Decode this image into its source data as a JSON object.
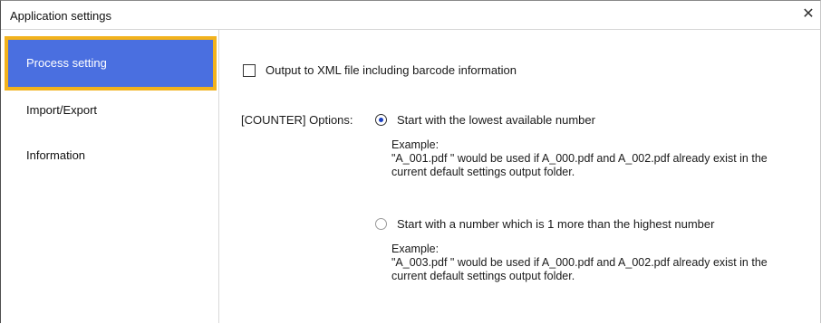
{
  "window": {
    "title": "Application settings",
    "close_glyph": "✕"
  },
  "sidebar": {
    "items": [
      {
        "label": "Process setting",
        "active": true
      },
      {
        "label": "Import/Export",
        "active": false
      },
      {
        "label": "Information",
        "active": false
      }
    ]
  },
  "process": {
    "xml_output": {
      "label": "Output to XML file including barcode information",
      "checked": false
    },
    "counter_label": "[COUNTER] Options:",
    "options": [
      {
        "label": "Start with the lowest available number",
        "selected": true,
        "example_title": "Example:",
        "example_line1": "\"A_001.pdf \" would be used if A_000.pdf and A_002.pdf already exist in the",
        "example_line2": "current default settings output folder."
      },
      {
        "label": "Start with a number which is 1 more than the highest number",
        "selected": false,
        "example_title": "Example:",
        "example_line1": "\"A_003.pdf \" would be used if A_000.pdf and A_002.pdf already exist in the",
        "example_line2": "current default settings output folder."
      }
    ]
  },
  "colors": {
    "active_nav": "#4a6fe0",
    "highlight_border": "#f2b21c"
  }
}
